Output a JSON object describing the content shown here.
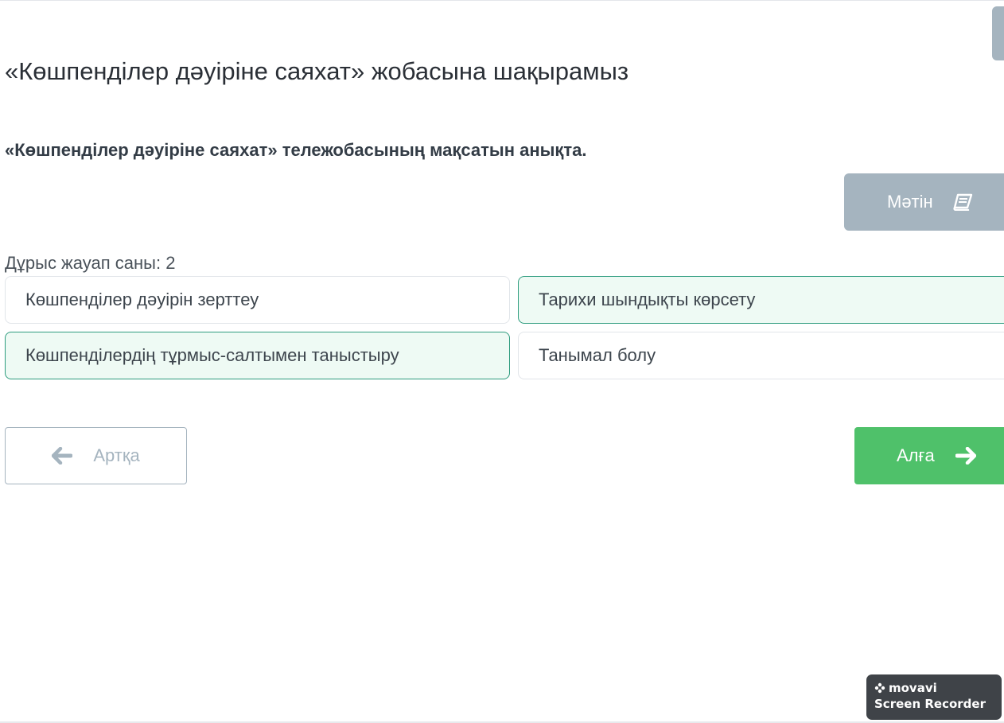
{
  "page": {
    "title": "«Көшпенділер дәуіріне саяхат» жобасына шақырамыз"
  },
  "question": {
    "text": "«Көшпенділер дәуіріне саяхат» тележобасының мақсатын анықта."
  },
  "text_button": {
    "label": "Мәтін",
    "icon": "book-icon"
  },
  "answer_count": {
    "label": "Дұрыс жауап саны: 2"
  },
  "options": [
    {
      "label": "Көшпенділер дәуірін зерттеу",
      "selected": false
    },
    {
      "label": "Тарихи шындықты көрсету",
      "selected": true
    },
    {
      "label": "Көшпенділердің тұрмыс-салтымен таныстыру",
      "selected": true
    },
    {
      "label": "Танымал болу",
      "selected": false
    }
  ],
  "navigation": {
    "back_label": "Артқа",
    "back_icon": "arrow-left-icon",
    "next_label": "Алға",
    "next_icon": "arrow-right-icon"
  },
  "watermark": {
    "brand": "movavi",
    "product": "Screen Recorder"
  },
  "colors": {
    "accent_green": "#4fc16a",
    "selected_border": "#2e9c7e",
    "selected_bg": "#eefaf4",
    "muted_gray": "#a5b4bf"
  }
}
